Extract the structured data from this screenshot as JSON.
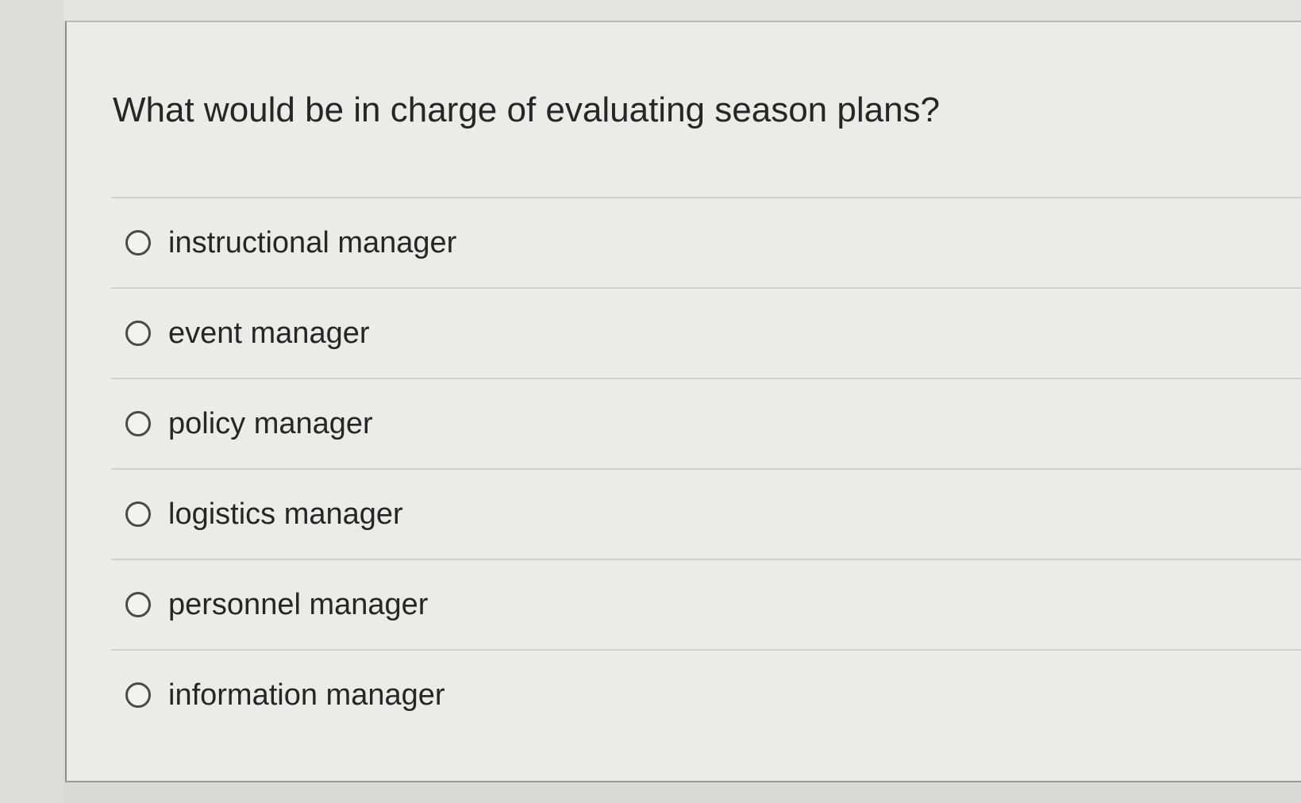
{
  "question": {
    "text": "What would be in charge of evaluating season plans?"
  },
  "options": [
    {
      "label": "instructional manager",
      "selected": false
    },
    {
      "label": "event manager",
      "selected": false
    },
    {
      "label": "policy manager",
      "selected": false
    },
    {
      "label": "logistics manager",
      "selected": false
    },
    {
      "label": "personnel manager",
      "selected": false
    },
    {
      "label": "information manager",
      "selected": false
    }
  ],
  "colors": {
    "page_background": "#d9d9d7",
    "card_background": "#ebebea",
    "text": "#262626",
    "radio_border": "#4a4a4a",
    "divider": "#cfcfcd"
  }
}
